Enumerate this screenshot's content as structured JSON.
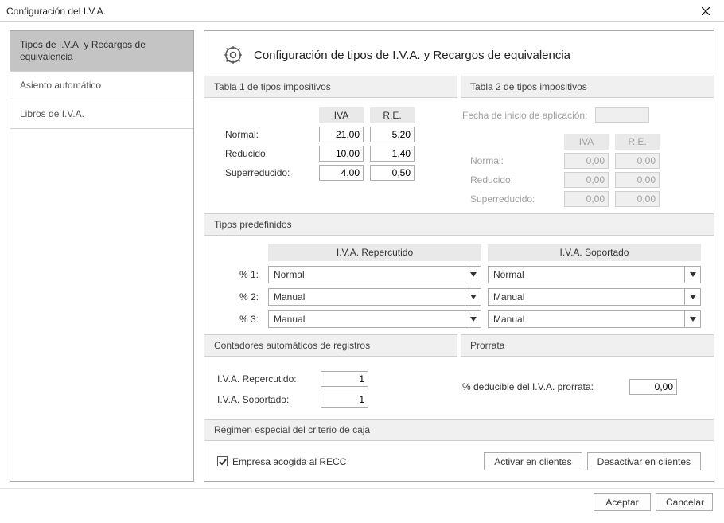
{
  "window": {
    "title": "Configuración del I.V.A."
  },
  "sidebar": {
    "items": [
      {
        "label": "Tipos de I.V.A. y Recargos de equivalencia",
        "selected": true
      },
      {
        "label": "Asiento automático",
        "selected": false
      },
      {
        "label": "Libros de I.V.A.",
        "selected": false
      }
    ]
  },
  "panel": {
    "title": "Configuración de tipos de I.V.A. y Recargos de equivalencia"
  },
  "tabla1": {
    "header": "Tabla 1 de tipos impositivos",
    "col_iva": "IVA",
    "col_re": "R.E.",
    "rows": {
      "normal": {
        "label": "Normal:",
        "iva": "21,00",
        "re": "5,20"
      },
      "reducido": {
        "label": "Reducido:",
        "iva": "10,00",
        "re": "1,40"
      },
      "superreducido": {
        "label": "Superreducido:",
        "iva": "4,00",
        "re": "0,50"
      }
    }
  },
  "tabla2": {
    "header": "Tabla 2 de tipos impositivos",
    "start_date_label": "Fecha de inicio de aplicación:",
    "start_date_value": "",
    "col_iva": "IVA",
    "col_re": "R.E.",
    "rows": {
      "normal": {
        "label": "Normal:",
        "iva": "0,00",
        "re": "0,00"
      },
      "reducido": {
        "label": "Reducido:",
        "iva": "0,00",
        "re": "0,00"
      },
      "superreducido": {
        "label": "Superreducido:",
        "iva": "0,00",
        "re": "0,00"
      }
    }
  },
  "predef": {
    "header": "Tipos predefinidos",
    "col_repercutido": "I.V.A. Repercutido",
    "col_soportado": "I.V.A. Soportado",
    "rows": [
      {
        "label": "% 1:",
        "repercutido": "Normal",
        "soportado": "Normal"
      },
      {
        "label": "% 2:",
        "repercutido": "Manual",
        "soportado": "Manual"
      },
      {
        "label": "% 3:",
        "repercutido": "Manual",
        "soportado": "Manual"
      }
    ]
  },
  "contadores": {
    "header": "Contadores automáticos de registros",
    "repercutido_label": "I.V.A. Repercutido:",
    "repercutido_value": "1",
    "soportado_label": "I.V.A. Soportado:",
    "soportado_value": "1"
  },
  "prorrata": {
    "header": "Prorrata",
    "label": "% deducible del I.V.A. prorrata:",
    "value": "0,00"
  },
  "recc": {
    "header": "Régimen especial del criterio de caja",
    "checkbox_label": "Empresa acogida al RECC",
    "checked": true,
    "btn_activar": "Activar en clientes",
    "btn_desactivar": "Desactivar en clientes"
  },
  "footer": {
    "ok": "Aceptar",
    "cancel": "Cancelar"
  }
}
